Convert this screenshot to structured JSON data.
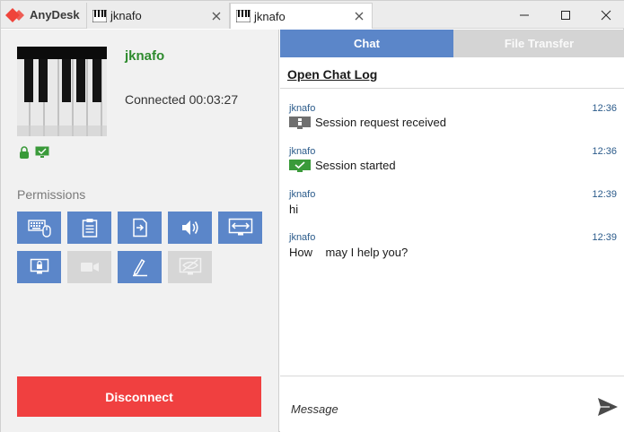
{
  "app": {
    "name": "AnyDesk",
    "brand_color": "#ef443b"
  },
  "tabs": [
    {
      "label": "jknafo",
      "active": false
    },
    {
      "label": "jknafo",
      "active": true
    }
  ],
  "session": {
    "remote_name": "jknafo",
    "status": "Connected 00:03:27",
    "permissions_label": "Permissions",
    "permissions": [
      {
        "icon": "keyboard-mouse-icon",
        "enabled": true
      },
      {
        "icon": "clipboard-icon",
        "enabled": true
      },
      {
        "icon": "file-transfer-icon",
        "enabled": true
      },
      {
        "icon": "sound-icon",
        "enabled": true
      },
      {
        "icon": "control-screen-icon",
        "enabled": true
      },
      {
        "icon": "lock-desk-icon",
        "enabled": true
      },
      {
        "icon": "video-icon",
        "enabled": false
      },
      {
        "icon": "draw-pen-icon",
        "enabled": true
      },
      {
        "icon": "privacy-screen-icon",
        "enabled": false
      }
    ],
    "disconnect_label": "Disconnect"
  },
  "panel": {
    "tabs": {
      "chat": "Chat",
      "file_transfer": "File Transfer"
    },
    "open_chat_log": "Open Chat Log",
    "messages": [
      {
        "author": "jknafo",
        "time": "12:36",
        "text": "Session request received",
        "icon": "session-request-icon"
      },
      {
        "author": "jknafo",
        "time": "12:36",
        "text": "Session started",
        "icon": "session-started-icon"
      },
      {
        "author": "jknafo",
        "time": "12:39",
        "text": "hi",
        "icon": ""
      },
      {
        "author": "jknafo",
        "time": "12:39",
        "text": "How    may I help you?",
        "icon": ""
      }
    ],
    "input_placeholder": "Message"
  },
  "colors": {
    "accent": "#5b86c9",
    "disconnect": "#f04040",
    "username": "#2e8b2e",
    "disabled": "#d6d6d6"
  }
}
